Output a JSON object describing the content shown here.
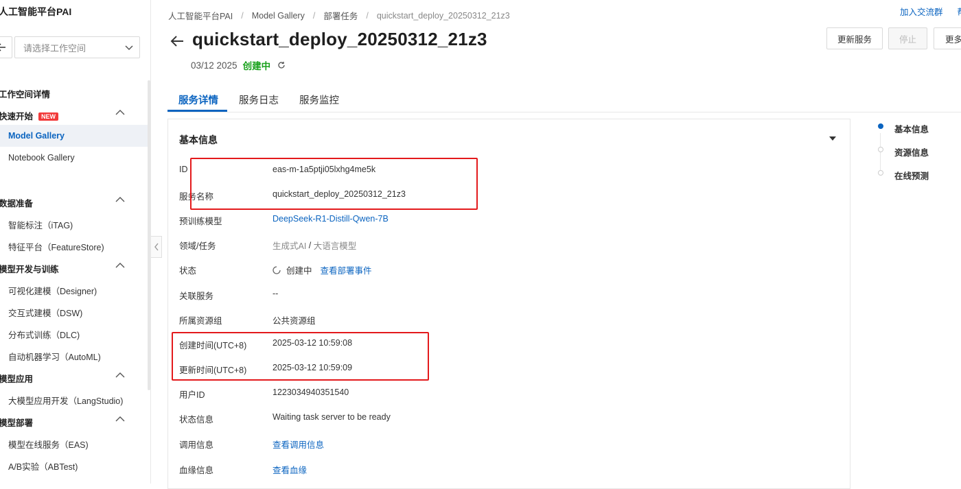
{
  "sidebar": {
    "brand": "人工智能平台PAI",
    "workspace_placeholder": "请选择工作空间",
    "sections": [
      {
        "label": "工作空间详情"
      },
      {
        "label": "快速开始",
        "badge": "NEW",
        "items": [
          "Model Gallery",
          "Notebook Gallery"
        ]
      },
      {
        "label": "数据准备",
        "items": [
          "智能标注（iTAG)",
          "特征平台（FeatureStore)"
        ]
      },
      {
        "label": "模型开发与训练",
        "items": [
          "可视化建模（Designer)",
          "交互式建模（DSW)",
          "分布式训练（DLC)",
          "自动机器学习（AutoML)"
        ]
      },
      {
        "label": "模型应用",
        "items": [
          "大模型应用开发（LangStudio)"
        ]
      },
      {
        "label": "模型部署",
        "items": [
          "模型在线服务（EAS)",
          "A/B实验（ABTest)"
        ]
      }
    ],
    "active_item": "Model Gallery"
  },
  "breadcrumb": [
    "人工智能平台PAI",
    "Model Gallery",
    "部署任务",
    "quickstart_deploy_20250312_21z3"
  ],
  "top_links": [
    "加入交流群",
    "帮"
  ],
  "header": {
    "title": "quickstart_deploy_20250312_21z3",
    "date": "03/12 2025",
    "status": "创建中",
    "buttons": {
      "update": "更新服务",
      "stop": "停止",
      "more": "更多"
    }
  },
  "tabs": [
    "服务详情",
    "服务日志",
    "服务监控"
  ],
  "card": {
    "title": "基本信息",
    "rows": [
      {
        "label": "ID",
        "value": "eas-m-1a5ptji05lxhg4me5k"
      },
      {
        "label": "服务名称",
        "value": "quickstart_deploy_20250312_21z3"
      },
      {
        "label": "预训练模型",
        "value": "DeepSeek-R1-Distill-Qwen-7B"
      },
      {
        "label": "领域/任务",
        "value_a": "生成式AI",
        "value_sep": " / ",
        "value_b": "大语言模型"
      },
      {
        "label": "状态",
        "value": "创建中",
        "link": "查看部署事件"
      },
      {
        "label": "关联服务",
        "value": "--"
      },
      {
        "label": "所属资源组",
        "value": "公共资源组"
      },
      {
        "label": "创建时间(UTC+8)",
        "value": "2025-03-12 10:59:08"
      },
      {
        "label": "更新时间(UTC+8)",
        "value": "2025-03-12 10:59:09"
      },
      {
        "label": "用户ID",
        "value": "1223034940351540"
      },
      {
        "label": "状态信息",
        "value": "Waiting task server to be ready"
      },
      {
        "label": "调用信息",
        "value": "查看调用信息"
      },
      {
        "label": "血缘信息",
        "value": "查看血缘"
      }
    ]
  },
  "anchor_nav": [
    "基本信息",
    "资源信息",
    "在线预测"
  ],
  "colors": {
    "accent": "#0b64c0",
    "success": "#19a11c",
    "highlight_box": "#e3191b"
  }
}
